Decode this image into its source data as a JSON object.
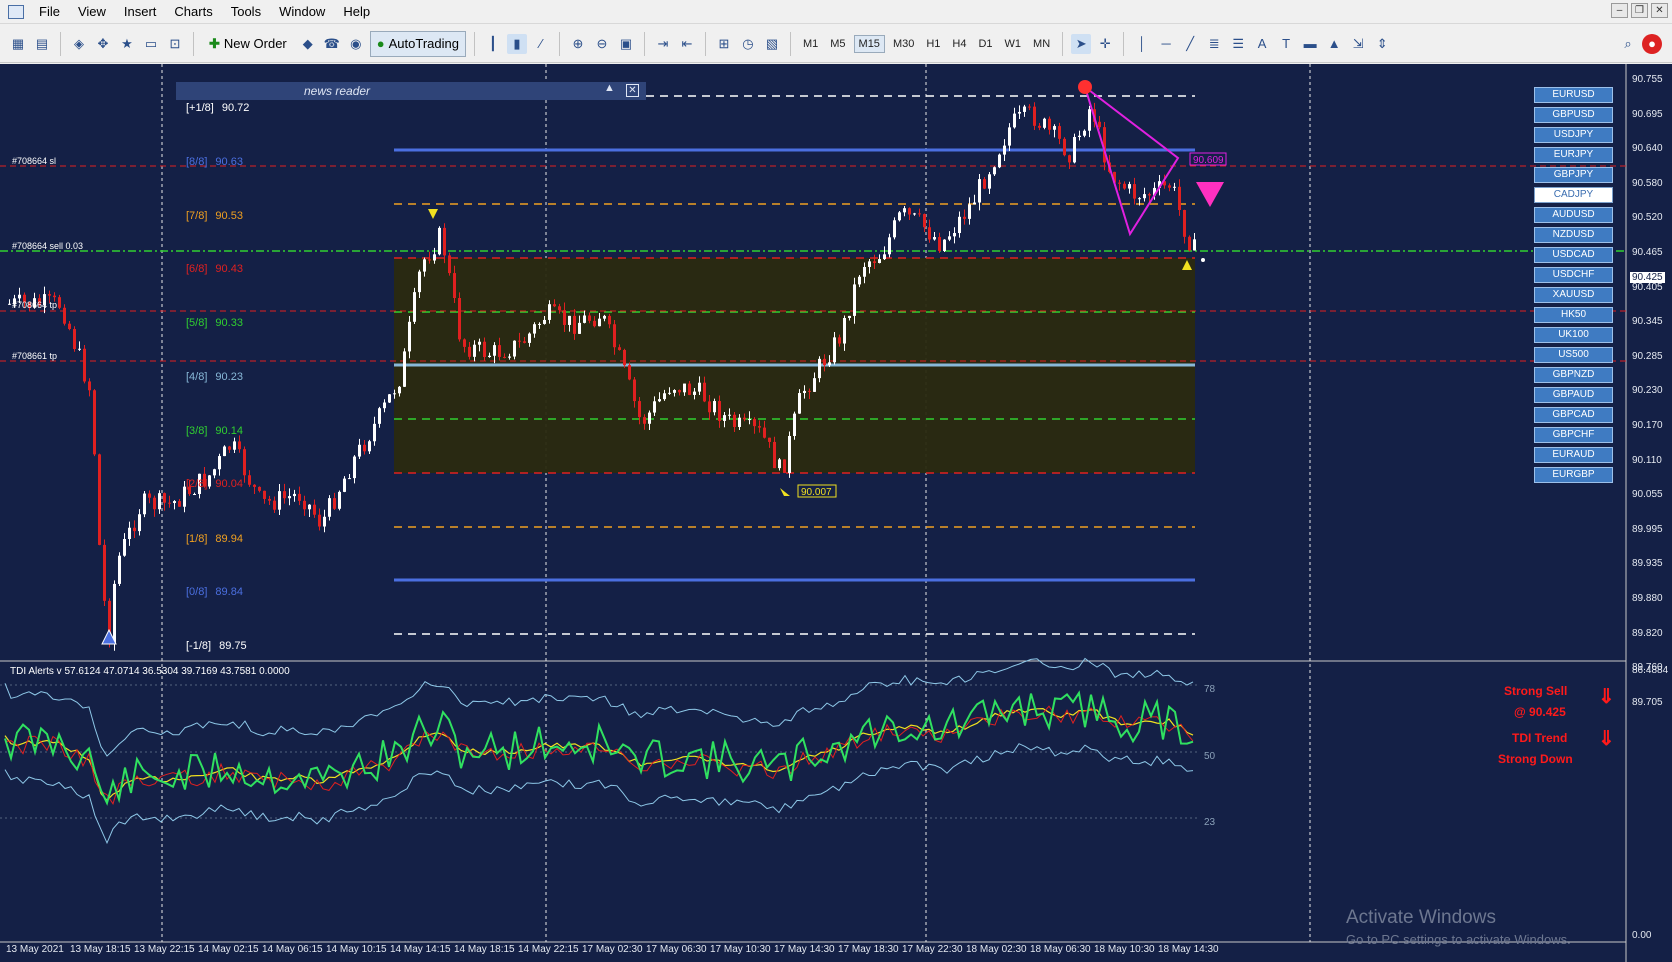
{
  "menu": [
    "File",
    "View",
    "Insert",
    "Charts",
    "Tools",
    "Window",
    "Help"
  ],
  "toolbar": {
    "new_order": "New Order",
    "autotrading": "AutoTrading",
    "timeframes": [
      "M1",
      "M5",
      "M15",
      "M30",
      "H1",
      "H4",
      "D1",
      "W1",
      "MN"
    ]
  },
  "news_reader": {
    "title": "news reader"
  },
  "murrey_math": [
    {
      "label": "[+1/8]",
      "value": "90.72",
      "color": "#ffffff"
    },
    {
      "label": "[8/8]",
      "value": "90.63",
      "color": "#4b6fe0"
    },
    {
      "label": "[7/8]",
      "value": "90.53",
      "color": "#f0a020"
    },
    {
      "label": "[6/8]",
      "value": "90.43",
      "color": "#e02020"
    },
    {
      "label": "[5/8]",
      "value": "90.33",
      "color": "#30d030"
    },
    {
      "label": "[4/8]",
      "value": "90.23",
      "color": "#88b8d8"
    },
    {
      "label": "[3/8]",
      "value": "90.14",
      "color": "#30d030"
    },
    {
      "label": "[2/8]",
      "value": "90.04",
      "color": "#e02020"
    },
    {
      "label": "[1/8]",
      "value": "89.94",
      "color": "#f0a020"
    },
    {
      "label": "[0/8]",
      "value": "89.84",
      "color": "#4b6fe0"
    },
    {
      "label": "[-1/8]",
      "value": "89.75",
      "color": "#ffffff"
    }
  ],
  "orders": [
    {
      "text": "#708664 sl"
    },
    {
      "text": "#708664 sell 0.03"
    },
    {
      "text": "#708664 tp"
    },
    {
      "text": "#708661 tp"
    }
  ],
  "markers": {
    "low_label": "90.007",
    "pattern_label": "90.609",
    "current_price": "90.425"
  },
  "symbols": [
    "EURUSD",
    "GBPUSD",
    "USDJPY",
    "EURJPY",
    "GBPJPY",
    "CADJPY",
    "AUDUSD",
    "NZDUSD",
    "USDCAD",
    "USDCHF",
    "XAUUSD",
    "HK50",
    "UK100",
    "US500",
    "GBPNZD",
    "GBPAUD",
    "GBPCAD",
    "GBPCHF",
    "EURAUD",
    "EURGBP"
  ],
  "active_symbol": "CADJPY",
  "price_axis": [
    "90.755",
    "90.695",
    "90.640",
    "90.580",
    "90.520",
    "90.465",
    "90.405",
    "90.345",
    "90.285",
    "90.230",
    "90.170",
    "90.110",
    "90.055",
    "89.995",
    "89.935",
    "89.880",
    "89.820",
    "89.760",
    "89.705"
  ],
  "time_axis": [
    "13 May 2021",
    "13 May 18:15",
    "13 May 22:15",
    "14 May 02:15",
    "14 May 06:15",
    "14 May 10:15",
    "14 May 14:15",
    "14 May 18:15",
    "14 May 22:15",
    "17 May 02:30",
    "17 May 06:30",
    "17 May 10:30",
    "17 May 14:30",
    "17 May 18:30",
    "17 May 22:30",
    "18 May 02:30",
    "18 May 06:30",
    "18 May 10:30",
    "18 May 14:30"
  ],
  "indicator": {
    "header": "TDI Alerts v 57.6124 47.0714 36.5304 39.7169 43.7581 0.0000",
    "levels": [
      "78",
      "50",
      "23"
    ],
    "axis_top": "86.4884",
    "axis_bottom": "0.00",
    "signals": {
      "line1": "Strong Sell",
      "line2": "@ 90.425",
      "line3": "TDI Trend",
      "line4": "Strong Down"
    }
  },
  "watermark": {
    "line1": "Activate Windows",
    "line2": "Go to PC settings to activate Windows."
  },
  "colors": {
    "chart_bg": "#142046",
    "bull_candle": "#ffffff",
    "bear_candle": "#e02020",
    "rsi_line": "#30e060",
    "signal_line": "#f0e020",
    "bands": "#8ec8e8"
  }
}
